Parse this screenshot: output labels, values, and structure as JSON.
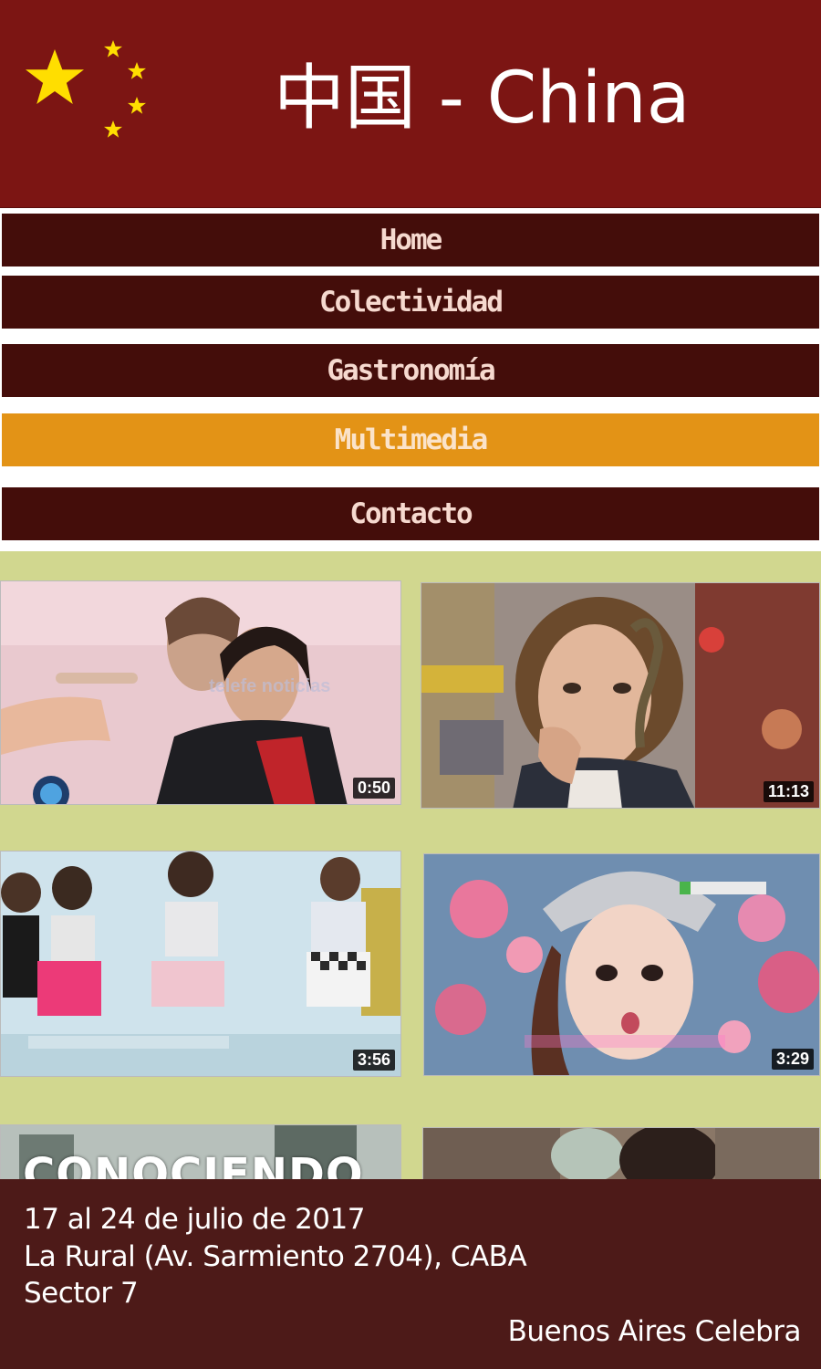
{
  "header": {
    "title": "中国 - China",
    "flag_icon": "china-flag-stars",
    "colors": {
      "background": "#7c1513",
      "star": "#ffde00"
    }
  },
  "nav": {
    "items": [
      {
        "label": "Home",
        "active": false
      },
      {
        "label": "Colectividad",
        "active": false
      },
      {
        "label": "Gastronomía",
        "active": false
      },
      {
        "label": "Multimedia",
        "active": true
      },
      {
        "label": "Contacto",
        "active": false
      }
    ],
    "colors": {
      "item": "#440d0a",
      "active": "#e39316",
      "text": "#f6d9cf"
    }
  },
  "videos": {
    "items": [
      {
        "duration": "0:50",
        "watermark": "telefe noticias"
      },
      {
        "duration": "11:13"
      },
      {
        "duration": "3:56"
      },
      {
        "duration": "3:29"
      },
      {
        "overlay_text": "CONOCIENDO"
      },
      {}
    ],
    "colors": {
      "background": "#d1d78f"
    }
  },
  "footer": {
    "line1": "17 al 24 de julio de 2017",
    "line2": "La Rural (Av. Sarmiento 2704), CABA",
    "line3": "Sector 7",
    "brand": "Buenos Aires Celebra",
    "colors": {
      "background": "#4d1a18"
    }
  }
}
